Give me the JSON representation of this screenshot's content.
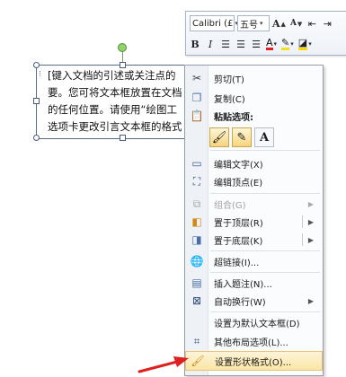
{
  "mini_toolbar": {
    "font_name": "Calibri (£",
    "font_size": "五号",
    "grow_font": "A",
    "shrink_font": "A",
    "bold": "B",
    "italic": "I",
    "font_color_letter": "A"
  },
  "textbox": {
    "lines": [
      "[键入文档的引述或关注点的",
      "要。您可将文本框放置在文档",
      "的任何位置。请使用“绘图工",
      "选项卡更改引言文本框的格式"
    ]
  },
  "context_menu": {
    "items": [
      {
        "label": "剪切(T)",
        "icon": "scissors-icon"
      },
      {
        "label": "复制(C)",
        "icon": "copy-icon"
      },
      {
        "label": "粘贴选项:",
        "icon": "paste-icon"
      },
      {
        "label": "编辑文字(X)",
        "icon": "edit-text-icon"
      },
      {
        "label": "编辑顶点(E)",
        "icon": "edit-points-icon"
      },
      {
        "label": "组合(G)",
        "icon": "group-icon",
        "disabled": true
      },
      {
        "label": "置于顶层(R)",
        "icon": "bring-front-icon"
      },
      {
        "label": "置于底层(K)",
        "icon": "send-back-icon"
      },
      {
        "label": "超链接(I)...",
        "icon": "hyperlink-icon"
      },
      {
        "label": "插入题注(N)...",
        "icon": "caption-icon"
      },
      {
        "label": "自动换行(W)",
        "icon": "wrap-icon"
      },
      {
        "label": "设置为默认文本框(D)",
        "icon": ""
      },
      {
        "label": "其他布局选项(L)...",
        "icon": "layout-icon"
      },
      {
        "label": "设置形状格式(O)...",
        "icon": "format-shape-icon"
      }
    ],
    "paste_keep_text_only": "A"
  },
  "colors": {
    "highlight": "#fbe6a6",
    "annotation_arrow": "#e02020"
  }
}
